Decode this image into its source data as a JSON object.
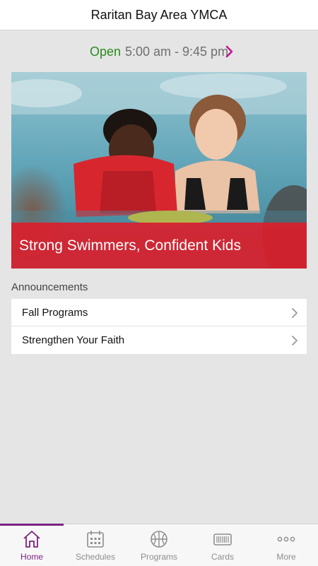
{
  "header": {
    "title": "Raritan Bay Area YMCA"
  },
  "hours": {
    "status": "Open",
    "time_range": "5:00 am - 9:45 pm"
  },
  "hero": {
    "caption": "Strong Swimmers, Confident Kids"
  },
  "announcements": {
    "label": "Announcements",
    "items": [
      {
        "label": "Fall Programs"
      },
      {
        "label": "Strengthen Your Faith"
      }
    ]
  },
  "tabbar": {
    "tabs": [
      {
        "label": "Home",
        "icon": "home-icon",
        "active": true
      },
      {
        "label": "Schedules",
        "icon": "calendar-icon",
        "active": false
      },
      {
        "label": "Programs",
        "icon": "basketball-icon",
        "active": false
      },
      {
        "label": "Cards",
        "icon": "barcode-card-icon",
        "active": false
      },
      {
        "label": "More",
        "icon": "more-icon",
        "active": false
      }
    ]
  },
  "colors": {
    "accent": "#7b2281",
    "open_green": "#2b8a1f",
    "banner_red": "#da202d",
    "chevron_magenta": "#c2188e"
  }
}
